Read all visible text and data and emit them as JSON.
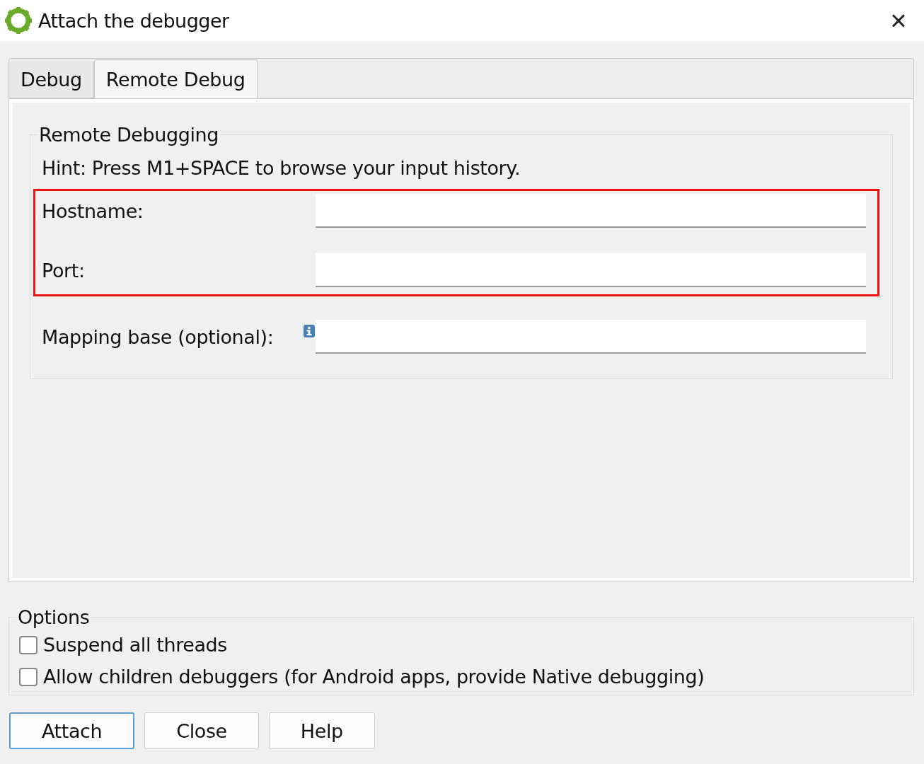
{
  "window": {
    "title": "Attach the debugger",
    "close_label": "×"
  },
  "tabs": [
    {
      "label": "Debug",
      "selected": false
    },
    {
      "label": "Remote Debug",
      "selected": true
    }
  ],
  "remote_debugging": {
    "title": "Remote Debugging",
    "hint": "Hint: Press M1+SPACE to browse your input history.",
    "fields": [
      {
        "label": "Hostname:",
        "highlighted": true,
        "info": false
      },
      {
        "label": "Port:",
        "highlighted": true,
        "info": false
      },
      {
        "label": "Mapping base (optional):",
        "highlighted": false,
        "info": true
      }
    ]
  },
  "options": {
    "title": "Options",
    "items": [
      {
        "label": "Suspend all threads",
        "checked": false
      },
      {
        "label": "Allow children debuggers (for Android apps, provide Native debugging)",
        "checked": false
      }
    ]
  },
  "buttons": [
    {
      "label": "Attach",
      "default": true
    },
    {
      "label": "Close",
      "default": false
    },
    {
      "label": "Help",
      "default": false
    }
  ]
}
